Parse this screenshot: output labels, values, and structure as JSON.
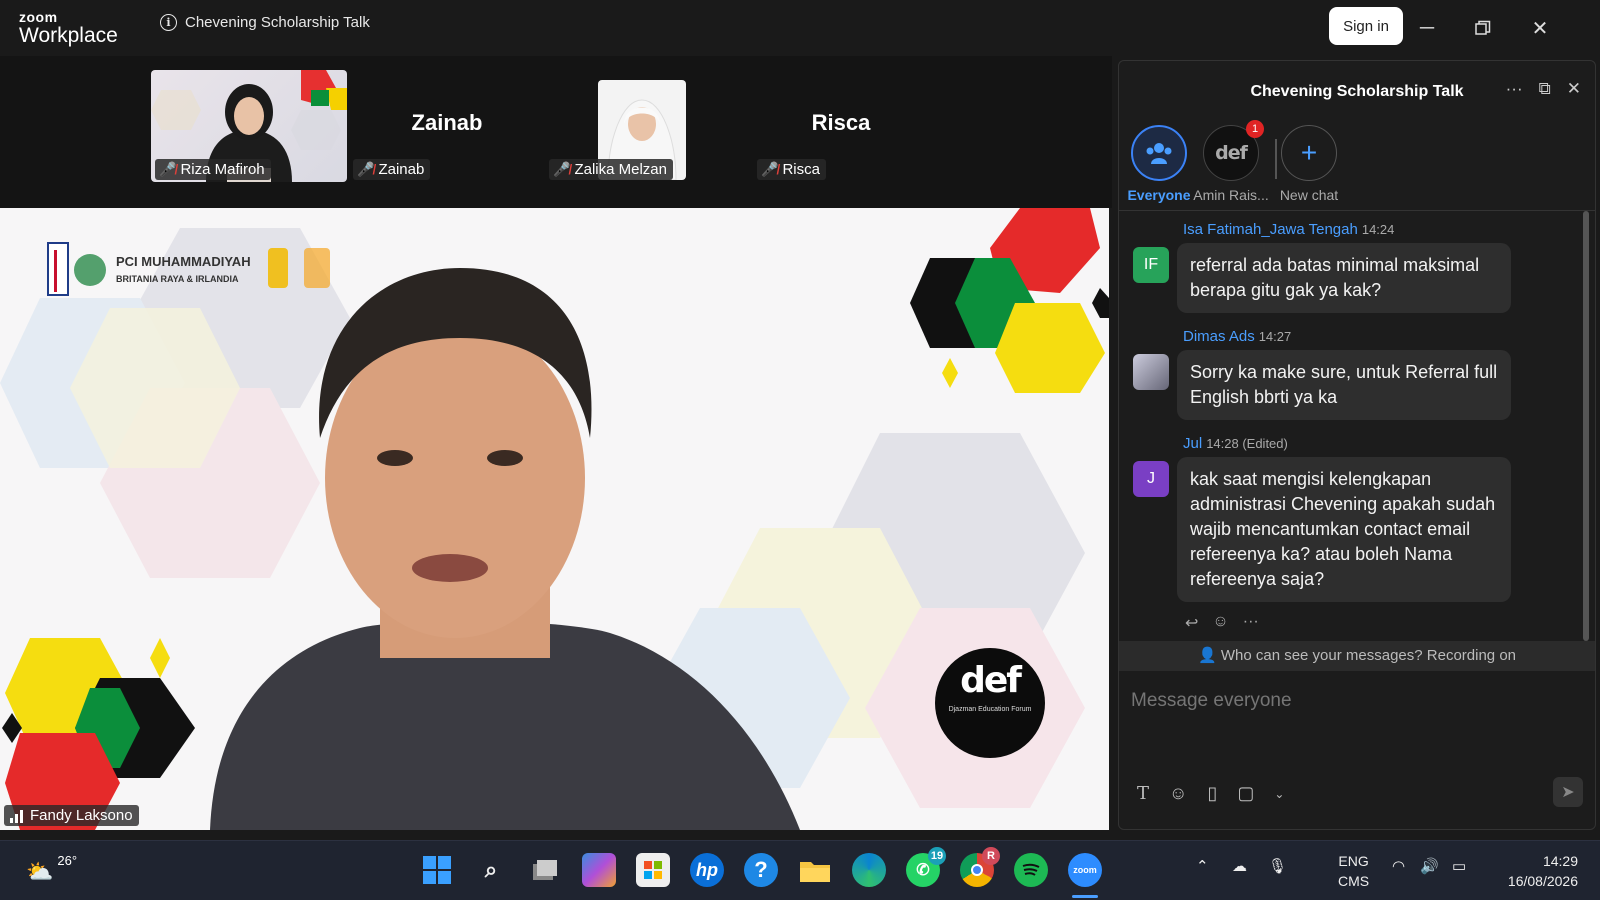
{
  "app": {
    "brand_top": "zoom",
    "brand_bottom": "Workplace",
    "meeting_title": "Chevening Scholarship Talk",
    "signin_label": "Sign in"
  },
  "participants": [
    {
      "name": "Riza Mafiroh",
      "muted": true
    },
    {
      "name": "Zainab",
      "muted": true,
      "display_name": "Zainab"
    },
    {
      "name": "Zalika Melzan",
      "muted": true
    },
    {
      "name": "Risca",
      "muted": true,
      "display_name": "Risca"
    }
  ],
  "main_video": {
    "speaker": "Fandy Laksono",
    "slide_text_1": "PCI MUHAMMADIYAH",
    "slide_text_2": "BRITANIA RAYA & IRLANDIA",
    "def_logo": "def",
    "def_sub": "Djazman Education Forum"
  },
  "chat": {
    "title": "Chevening Scholarship Talk",
    "recipients": [
      {
        "label": "Everyone",
        "selected": true
      },
      {
        "label": "Amin Rais...",
        "badge": "1"
      },
      {
        "label": "New chat"
      }
    ],
    "messages": [
      {
        "sender": "Isa Fatimah_Jawa Tengah",
        "time": "14:24",
        "avatar": "IF",
        "text": "referral ada batas minimal maksimal berapa gitu gak ya kak?"
      },
      {
        "sender": "Dimas Ads",
        "time": "14:27",
        "avatar": "",
        "text": "Sorry ka make sure, untuk Referral full English bbrti ya ka"
      },
      {
        "sender": "Jul",
        "time": "14:28 (Edited)",
        "avatar": "J",
        "text": "kak saat mengisi kelengkapan administrasi Chevening apakah sudah wajib mencantumkan contact email refereenya ka? atau boleh Nama refereenya saja?"
      }
    ],
    "privacy_notice": "Who can see your messages? Recording on",
    "compose_placeholder": "Message everyone"
  },
  "taskbar": {
    "temperature": "26°",
    "whatsapp_badge": "19",
    "chrome_badge": "R",
    "lang_1": "ENG",
    "lang_2": "CMS",
    "time": "14:29",
    "date": "16/08/2026"
  }
}
